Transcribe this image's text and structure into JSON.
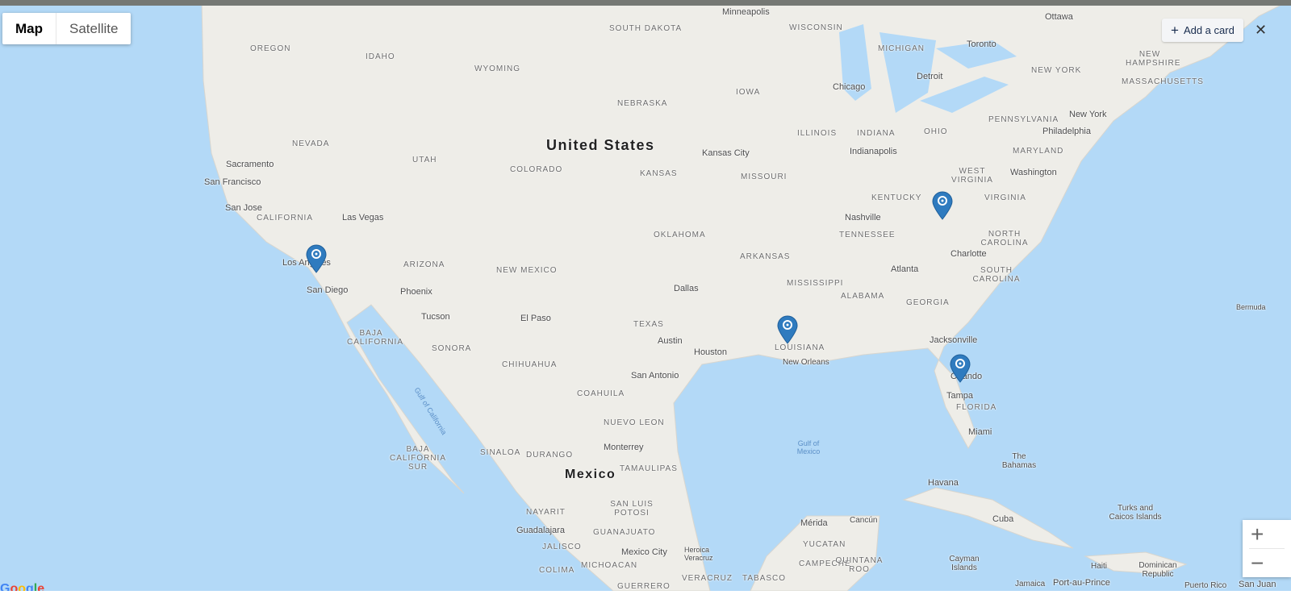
{
  "map_type": {
    "options": [
      "Map",
      "Satellite"
    ],
    "selected": "Map"
  },
  "add_card": {
    "icon": "plus-icon",
    "label": "Add a card"
  },
  "close_icon": "close-icon",
  "zoom": {
    "in": "+",
    "out": "−"
  },
  "logo": "Google",
  "country_labels": [
    "United States",
    "Mexico"
  ],
  "state_labels": [
    "OREGON",
    "IDAHO",
    "WYOMING",
    "SOUTH DAKOTA",
    "NEBRASKA",
    "NEVADA",
    "UTAH",
    "COLORADO",
    "KANSAS",
    "CALIFORNIA",
    "ARIZONA",
    "NEW MEXICO",
    "OKLAHOMA",
    "TEXAS",
    "IOWA",
    "MISSOURI",
    "ARKANSAS",
    "LOUISIANA",
    "MISSISSIPPI",
    "ALABAMA",
    "GEORGIA",
    "FLORIDA",
    "TENNESSEE",
    "KENTUCKY",
    "ILLINOIS",
    "INDIANA",
    "OHIO",
    "WISCONSIN",
    "MICHIGAN",
    "PENNSYLVANIA",
    "NEW YORK",
    "WEST VIRGINIA",
    "VIRGINIA",
    "NORTH CAROLINA",
    "SOUTH CAROLINA",
    "MARYLAND",
    "NEW HAMPSHIRE",
    "MASSACHUSETTS",
    "BAJA CALIFORNIA",
    "BAJA CALIFORNIA SUR",
    "SONORA",
    "CHIHUAHUA",
    "COAHUILA",
    "NUEVO LEON",
    "TAMAULIPAS",
    "SINALOA",
    "DURANGO",
    "NAYARIT",
    "JALISCO",
    "GUANAJUATO",
    "SAN LUIS POTOSI",
    "MICHOACAN",
    "YUCATAN",
    "CAMPECHE",
    "QUINTANA ROO",
    "TABASCO",
    "VERACRUZ",
    "COLIMA",
    "GUERRERO"
  ],
  "city_labels": [
    "Minneapolis",
    "Ottawa",
    "Toronto",
    "Detroit",
    "Chicago",
    "Indianapolis",
    "Kansas City",
    "Sacramento",
    "San Francisco",
    "San Jose",
    "Las Vegas",
    "Los Angeles",
    "San Diego",
    "Phoenix",
    "Tucson",
    "El Paso",
    "Dallas",
    "Austin",
    "Houston",
    "San Antonio",
    "New Orleans",
    "Nashville",
    "Atlanta",
    "Charlotte",
    "Jacksonville",
    "Orlando",
    "Tampa",
    "Miami",
    "Washington",
    "Philadelphia",
    "New York",
    "Monterrey",
    "Guadalajara",
    "Mexico City",
    "Heroica Veracruz",
    "Mérida",
    "Cancún",
    "Havana",
    "Cuba",
    "The Bahamas",
    "Turks and Caicos Islands",
    "Cayman Islands",
    "Haiti",
    "Dominican Republic",
    "Jamaica",
    "Port-au-Prince",
    "Puerto Rico",
    "San Juan",
    "Bermuda"
  ],
  "water_labels": [
    "Gulf of Mexico",
    "Gulf of California"
  ],
  "markers": [
    {
      "near": "Los Angeles"
    },
    {
      "near": "Virginia / Kentucky"
    },
    {
      "near": "Louisiana"
    },
    {
      "near": "Orlando"
    }
  ],
  "colors": {
    "water": "#b3d9f7",
    "land": "#eeede8",
    "marker": "#2f7bbf"
  }
}
